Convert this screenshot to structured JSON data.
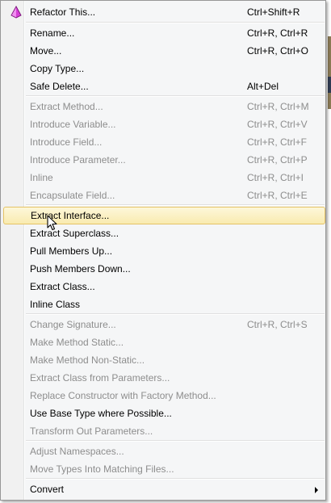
{
  "menu": {
    "refactor_this": {
      "label": "Refactor This...",
      "shortcut": "Ctrl+Shift+R",
      "icon": "refactor-gem-icon"
    },
    "group1": [
      {
        "name": "rename",
        "label": "Rename...",
        "shortcut": "Ctrl+R, Ctrl+R"
      },
      {
        "name": "move",
        "label": "Move...",
        "shortcut": "Ctrl+R, Ctrl+O"
      },
      {
        "name": "copy-type",
        "label": "Copy Type...",
        "shortcut": ""
      },
      {
        "name": "safe-delete",
        "label": "Safe Delete...",
        "shortcut": "Alt+Del"
      }
    ],
    "group2": [
      {
        "name": "extract-method",
        "label": "Extract Method...",
        "shortcut": "Ctrl+R, Ctrl+M"
      },
      {
        "name": "introduce-variable",
        "label": "Introduce Variable...",
        "shortcut": "Ctrl+R, Ctrl+V"
      },
      {
        "name": "introduce-field",
        "label": "Introduce Field...",
        "shortcut": "Ctrl+R, Ctrl+F"
      },
      {
        "name": "introduce-parameter",
        "label": "Introduce Parameter...",
        "shortcut": "Ctrl+R, Ctrl+P"
      },
      {
        "name": "inline",
        "label": "Inline",
        "shortcut": "Ctrl+R, Ctrl+I"
      },
      {
        "name": "encapsulate-field",
        "label": "Encapsulate Field...",
        "shortcut": "Ctrl+R, Ctrl+E"
      }
    ],
    "group3": [
      {
        "name": "extract-interface",
        "label": "Extract Interface..."
      },
      {
        "name": "extract-superclass",
        "label": "Extract Superclass..."
      },
      {
        "name": "pull-members-up",
        "label": "Pull Members Up..."
      },
      {
        "name": "push-members-down",
        "label": "Push Members Down..."
      },
      {
        "name": "extract-class",
        "label": "Extract Class..."
      },
      {
        "name": "inline-class",
        "label": "Inline Class"
      }
    ],
    "group4": [
      {
        "name": "change-signature",
        "label": "Change Signature...",
        "shortcut": "Ctrl+R, Ctrl+S"
      },
      {
        "name": "make-method-static",
        "label": "Make Method Static..."
      },
      {
        "name": "make-method-non-static",
        "label": "Make Method Non-Static..."
      },
      {
        "name": "extract-class-from-parameters",
        "label": "Extract Class from Parameters..."
      },
      {
        "name": "replace-constructor",
        "label": "Replace Constructor with Factory Method..."
      },
      {
        "name": "use-base-type",
        "label": "Use Base Type where Possible..."
      },
      {
        "name": "transform-out-parameters",
        "label": "Transform Out Parameters..."
      }
    ],
    "group5": [
      {
        "name": "adjust-namespaces",
        "label": "Adjust Namespaces..."
      },
      {
        "name": "move-types",
        "label": "Move Types Into Matching Files..."
      }
    ],
    "convert": {
      "label": "Convert",
      "icon": "chevron-right-icon"
    }
  },
  "colors": {
    "highlight_top": "#fdf7d9",
    "highlight_bottom": "#f9ebb0",
    "highlight_border": "#e5c365",
    "disabled_text": "#8d8d8d",
    "gem": "#d43fd4"
  }
}
